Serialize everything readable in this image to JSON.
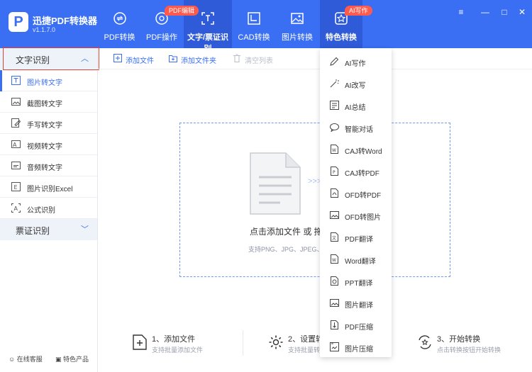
{
  "app": {
    "name": "迅捷PDF转换器",
    "version": "v1.1.7.0",
    "logo_letter": "P"
  },
  "tabs": [
    {
      "label": "PDF转换",
      "icon": "pdf-convert-icon"
    },
    {
      "label": "PDF操作",
      "icon": "pdf-edit-icon"
    },
    {
      "label": "文字/票证识别",
      "icon": "ocr-scan-icon"
    },
    {
      "label": "CAD转换",
      "icon": "cad-icon"
    },
    {
      "label": "图片转换",
      "icon": "image-icon"
    },
    {
      "label": "特色转换",
      "icon": "star-box-icon"
    }
  ],
  "badges": {
    "pdf_edit": "PDF编辑",
    "ai_write": "AI写作"
  },
  "sidebar": {
    "section1": "文字识别",
    "items": [
      {
        "label": "图片转文字",
        "icon": "text-t-icon"
      },
      {
        "label": "截图转文字",
        "icon": "screenshot-icon"
      },
      {
        "label": "手写转文字",
        "icon": "handwriting-icon"
      },
      {
        "label": "视频转文字",
        "icon": "video-text-icon"
      },
      {
        "label": "音频转文字",
        "icon": "audio-icon"
      },
      {
        "label": "图片识别Excel",
        "icon": "excel-icon"
      },
      {
        "label": "公式识别",
        "icon": "formula-icon"
      }
    ],
    "section2": "票证识别",
    "footer_left": "在线客服",
    "footer_right": "特色产品"
  },
  "toolbar": {
    "add_file": "添加文件",
    "add_folder": "添加文件夹",
    "clear_list": "清空列表"
  },
  "dropzone": {
    "main_text": "点击添加文件 或 拖",
    "sub_text": "支持PNG、JPG、JPEG、"
  },
  "steps": [
    {
      "title": "1、添加文件",
      "sub": "支持批量添加文件"
    },
    {
      "title": "2、设置转",
      "sub": "支持批量转换"
    },
    {
      "title": "3、开始转换",
      "sub": "点击转换按钮开始转换"
    }
  ],
  "menu": [
    {
      "label": "AI写作",
      "icon": "pen-icon"
    },
    {
      "label": "AI改写",
      "icon": "magic-wand-icon"
    },
    {
      "label": "AI总结",
      "icon": "summary-icon"
    },
    {
      "label": "智能对话",
      "icon": "chat-icon"
    },
    {
      "label": "CAJ转Word",
      "icon": "word-doc-icon"
    },
    {
      "label": "CAJ转PDF",
      "icon": "pdf-doc-icon"
    },
    {
      "label": "OFD转PDF",
      "icon": "ofd-pdf-icon"
    },
    {
      "label": "OFD转图片",
      "icon": "ofd-image-icon"
    },
    {
      "label": "PDF翻译",
      "icon": "pdf-translate-icon"
    },
    {
      "label": "Word翻译",
      "icon": "word-translate-icon"
    },
    {
      "label": "PPT翻译",
      "icon": "ppt-translate-icon"
    },
    {
      "label": "图片翻译",
      "icon": "image-translate-icon"
    },
    {
      "label": "PDF压缩",
      "icon": "pdf-compress-icon"
    },
    {
      "label": "图片压缩",
      "icon": "image-compress-icon"
    }
  ],
  "colors": {
    "brand": "#3a6ff4",
    "badge": "#ff5a4e",
    "highlight_frame": "#e0403a"
  }
}
